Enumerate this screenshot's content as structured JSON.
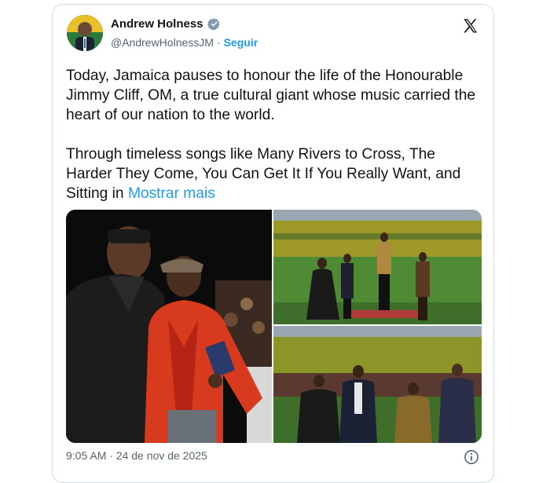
{
  "post": {
    "author": {
      "name": "Andrew Holness",
      "handle": "@AndrewHolnessJM",
      "separator": "·",
      "follow_label": "Seguir",
      "verified_icon": "verified-badge-icon"
    },
    "platform_icon": "x-logo-icon",
    "text_main": "Today, Jamaica pauses to honour the life of the Honourable Jimmy Cliff, OM, a true cultural giant whose music carried the heart of our nation to the world.\n\nThrough timeless songs like Many Rivers to Cross, The Harder They Come, You Can Get It If You Really Want, and Sitting in ",
    "show_more_label": "Mostrar mais",
    "media_count": 3,
    "timestamp": "9:05 AM · 24 de nov de 2025",
    "info_icon": "info-icon"
  },
  "colors": {
    "link_blue": "#1d9bf0",
    "text": "#0f1419",
    "muted": "#536471",
    "border": "#cfd9de",
    "verified_gray": "#829aab"
  }
}
